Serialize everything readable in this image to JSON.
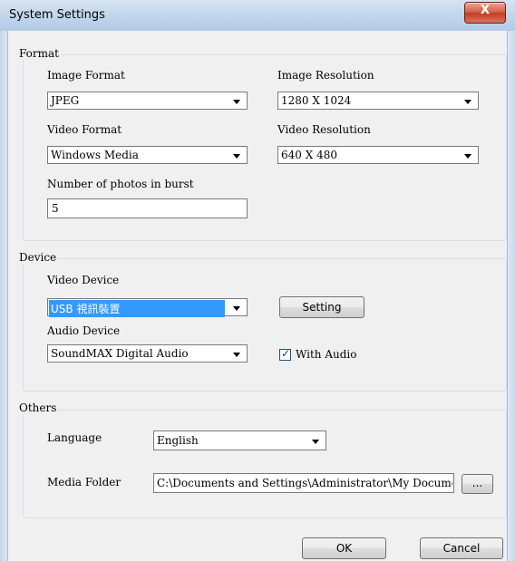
{
  "window": {
    "title": "System Settings",
    "close_glyph": "X"
  },
  "format": {
    "legend": "Format",
    "image_format": {
      "label": "Image Format",
      "value": "JPEG"
    },
    "image_resolution": {
      "label": "Image Resolution",
      "value": "1280 X 1024"
    },
    "video_format": {
      "label": "Video Format",
      "value": "Windows Media"
    },
    "video_resolution": {
      "label": "Video Resolution",
      "value": "640 X 480"
    },
    "burst": {
      "label": "Number of photos in burst",
      "value": "5"
    }
  },
  "device": {
    "legend": "Device",
    "video_device": {
      "label": "Video Device",
      "value": "USB 視訊裝置"
    },
    "setting_button": "Setting",
    "audio_device": {
      "label": "Audio Device",
      "value": "SoundMAX Digital Audio"
    },
    "with_audio": {
      "label": "With Audio",
      "checked": true
    }
  },
  "others": {
    "legend": "Others",
    "language": {
      "label": "Language",
      "value": "English"
    },
    "media_folder": {
      "label": "Media Folder",
      "value": "C:\\Documents and Settings\\Administrator\\My Documents",
      "browse_label": "..."
    }
  },
  "buttons": {
    "ok": "OK",
    "cancel": "Cancel"
  }
}
